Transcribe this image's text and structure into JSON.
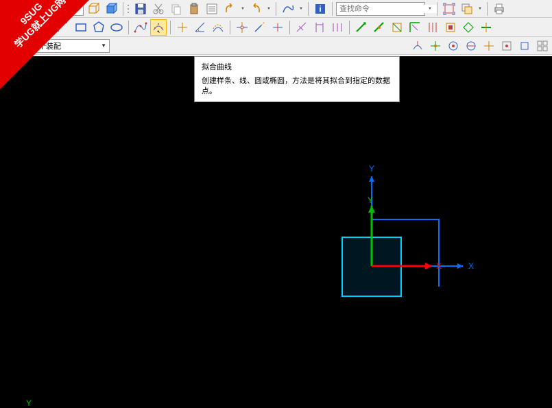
{
  "watermark": {
    "line1": "9SUG",
    "line2": "学UG就上UG网"
  },
  "top_combo": {
    "value": ""
  },
  "search": {
    "placeholder": "查找命令"
  },
  "assembly_combo": {
    "value": "整个装配"
  },
  "tooltip": {
    "title": "拟合曲线",
    "description": "创建样条、线、圆或椭圆，方法是将其拟合到指定的数据点。"
  },
  "axes": {
    "x_label": "X",
    "y_label": "Y",
    "x2_label": "X",
    "y2_label": "Y",
    "legend_y": "Y"
  },
  "colors": {
    "accent_green": "#00c000",
    "accent_red": "#ff0000",
    "accent_blue": "#0070ff",
    "accent_cyan": "#00d0ff"
  }
}
